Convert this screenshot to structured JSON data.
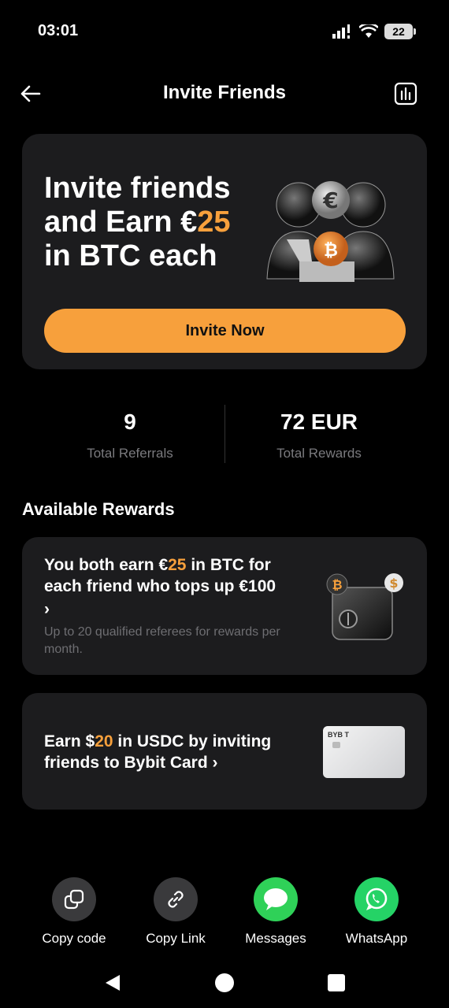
{
  "status": {
    "time": "03:01",
    "battery": "22"
  },
  "header": {
    "title": "Invite Friends"
  },
  "hero": {
    "line1": "Invite friends",
    "line2_prefix": "and Earn €",
    "line2_amount": "25",
    "line3": "in BTC each",
    "button_label": "Invite Now"
  },
  "stats": {
    "referrals_value": "9",
    "referrals_label": "Total Referrals",
    "rewards_value": "72 EUR",
    "rewards_label": "Total Rewards"
  },
  "section_title": "Available Rewards",
  "rewards": [
    {
      "title_prefix": "You both earn €",
      "title_amount": "25",
      "title_suffix": " in BTC for each friend who tops up €100",
      "chevron": "›",
      "subtitle": "Up to 20 qualified referees for rewards per month."
    },
    {
      "title_prefix": "Earn $",
      "title_amount": "20",
      "title_suffix": " in USDC by inviting friends to Bybit Card ",
      "chevron": "›",
      "card_brand": "BYB T"
    }
  ],
  "share": [
    {
      "label": "Copy code",
      "icon": "copy-icon"
    },
    {
      "label": "Copy Link",
      "icon": "link-icon"
    },
    {
      "label": "Messages",
      "icon": "messages-icon"
    },
    {
      "label": "WhatsApp",
      "icon": "whatsapp-icon"
    }
  ],
  "colors": {
    "accent": "#f7a03c",
    "card_bg": "#1c1c1e",
    "background": "#000000"
  }
}
